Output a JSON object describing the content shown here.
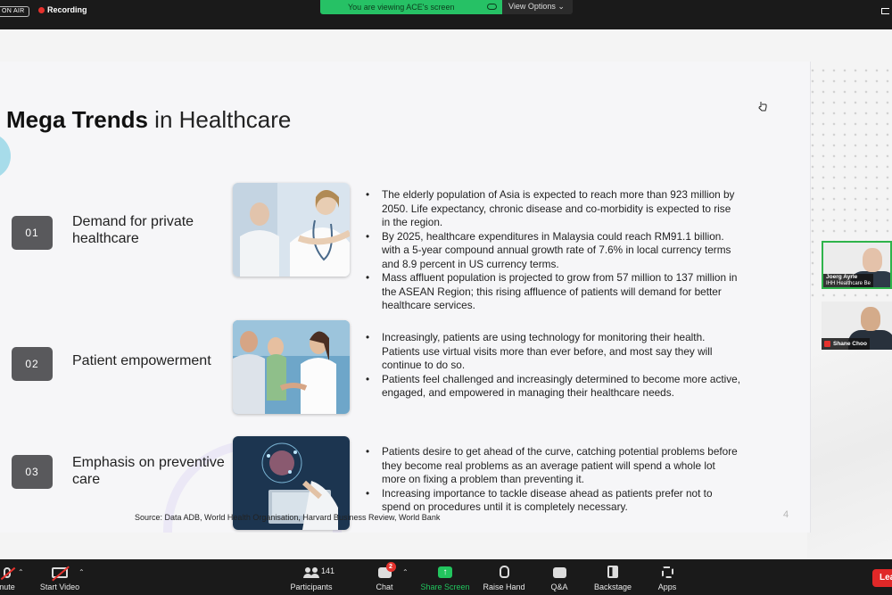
{
  "topbar": {
    "on_air": "ON AIR",
    "recording": "Recording",
    "viewing_banner": "You are viewing ACE's screen",
    "view_options": "View Options ⌄"
  },
  "slide": {
    "title_bold": "Mega Trends",
    "title_rest": " in Healthcare",
    "rows": [
      {
        "num": "01",
        "title": "Demand for private healthcare",
        "bullets": [
          "The elderly population of Asia is expected to reach more than 923 million by 2050. Life expectancy, chronic disease and co-morbidity is expected to rise in the region.",
          "By 2025, healthcare expenditures in Malaysia could reach RM91.1 billion. with a 5-year compound annual growth rate of 7.6% in local currency terms and 8.9 percent in US currency terms.",
          "Mass affluent population is projected to grow from 57 million to 137 million in the ASEAN Region; this rising affluence of patients will demand for better healthcare services."
        ]
      },
      {
        "num": "02",
        "title": "Patient empowerment",
        "bullets": [
          "Increasingly, patients are using technology for monitoring their health. Patients use virtual visits more than ever before, and most say they will continue to do so.",
          "Patients feel challenged and increasingly determined to become more active, engaged, and empowered in managing their healthcare needs."
        ]
      },
      {
        "num": "03",
        "title": "Emphasis on preventive care",
        "bullets": [
          "Patients desire to get ahead of the curve, catching potential problems before they become real problems as an average patient will spend a whole lot more on fixing a problem than preventing it.",
          "Increasing importance to tackle disease ahead as patients prefer not to spend on procedures until it is completely necessary."
        ]
      }
    ],
    "source": "Source: Data ADB, World Health Organisation, Harvard Business Review, World Bank",
    "page_number": "4"
  },
  "participants": [
    {
      "name": "Joerg Ayrle",
      "org": "IHH Healthcare Be"
    },
    {
      "name": "Shane Choo"
    }
  ],
  "toolbar": {
    "mute": "nute",
    "start_video": "Start Video",
    "participants": "Participants",
    "participants_count": "141",
    "chat": "Chat",
    "chat_badge": "2",
    "share_screen": "Share Screen",
    "raise_hand": "Raise Hand",
    "qa": "Q&A",
    "backstage": "Backstage",
    "apps": "Apps",
    "leave": "Lea"
  },
  "colors": {
    "banner_green": "#26c165",
    "share_green": "#22c55e",
    "record_red": "#e5322d",
    "number_box": "#59595c"
  }
}
